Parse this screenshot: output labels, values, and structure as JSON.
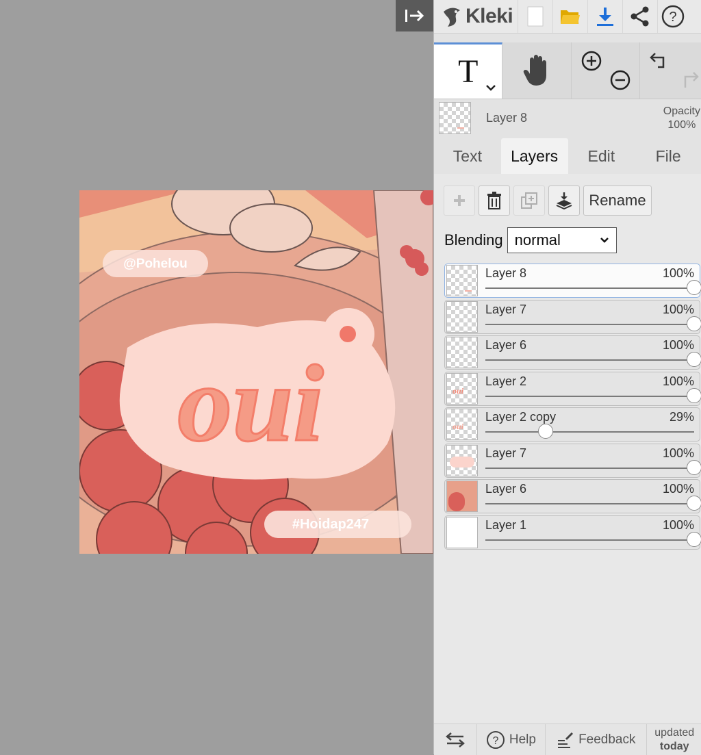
{
  "app": {
    "name": "Kleki"
  },
  "canvas": {
    "watermark_top": "@Pohelou",
    "main_text": "oui",
    "watermark_bottom": "#Hoidap247"
  },
  "toolbar": {
    "active_tool": "T",
    "tools": [
      "text-tool",
      "hand-tool",
      "zoom-tools",
      "undo-redo"
    ]
  },
  "current_layer": {
    "name": "Layer 8",
    "opacity_label": "Opacity",
    "opacity_value": "100%"
  },
  "tabs": [
    {
      "label": "Text"
    },
    {
      "label": "Layers",
      "active": true
    },
    {
      "label": "Edit"
    },
    {
      "label": "File"
    }
  ],
  "layers_panel": {
    "rename_label": "Rename",
    "blending_label": "Blending",
    "blending_value": "normal",
    "layers": [
      {
        "name": "Layer 8",
        "opacity": "100%",
        "value": 1.0,
        "active": true
      },
      {
        "name": "Layer 7",
        "opacity": "100%",
        "value": 1.0
      },
      {
        "name": "Layer 6",
        "opacity": "100%",
        "value": 1.0
      },
      {
        "name": "Layer 2",
        "opacity": "100%",
        "value": 1.0
      },
      {
        "name": "Layer 2 copy",
        "opacity": "29%",
        "value": 0.29
      },
      {
        "name": "Layer 7",
        "opacity": "100%",
        "value": 1.0
      },
      {
        "name": "Layer 6",
        "opacity": "100%",
        "value": 1.0
      },
      {
        "name": "Layer 1",
        "opacity": "100%",
        "value": 1.0
      }
    ]
  },
  "footer": {
    "help_label": "Help",
    "feedback_label": "Feedback",
    "updated_line1": "updated",
    "updated_line2": "today"
  },
  "colors": {
    "accent": "#1e6fd9",
    "folder": "#f4c430",
    "canvas_bg": "#9e9e9e"
  }
}
